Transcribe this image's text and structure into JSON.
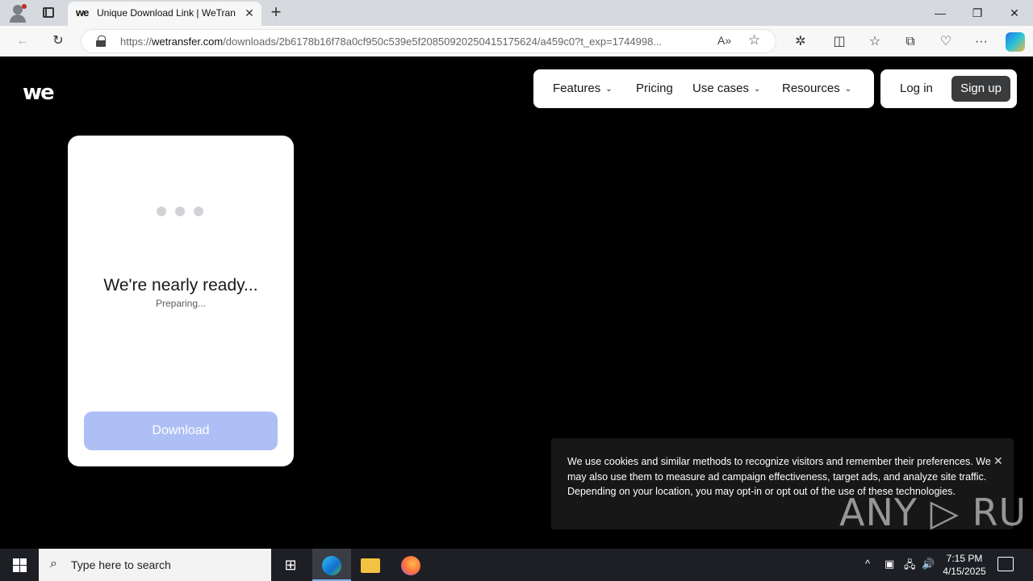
{
  "browser": {
    "tab_title": "Unique Download Link | WeTransfer",
    "tab_favicon": "we",
    "url_host": "wetransfer.com",
    "url_prefix": "https://",
    "url_path": "/downloads/2b6178b16f78a0cf950c539e5f20850920250415175624/a459c0?t_exp=1744998...",
    "window_controls": {
      "minimize": "—",
      "restore": "❐",
      "close": "✕"
    },
    "new_tab": "+",
    "tab_close": "✕"
  },
  "site": {
    "logo": "we",
    "nav": [
      {
        "label": "Features",
        "has_dropdown": true
      },
      {
        "label": "Pricing",
        "has_dropdown": false
      },
      {
        "label": "Use cases",
        "has_dropdown": true
      },
      {
        "label": "Resources",
        "has_dropdown": true
      }
    ],
    "login": "Log in",
    "signup": "Sign up"
  },
  "card": {
    "headline": "We're nearly ready...",
    "status": "Preparing...",
    "download_button": "Download",
    "download_color": "#aebff5"
  },
  "cookie": {
    "message": "We use cookies and similar methods to recognize visitors and remember their preferences. We may also use them to measure ad campaign effectiveness, target ads, and analyze site traffic. Depending on your location, you may opt-in or opt out of the use of these technologies.",
    "close": "✕"
  },
  "watermark": "ANY ▷ RUN",
  "taskbar": {
    "search_placeholder": "Type here to search",
    "time": "7:15 PM",
    "date": "4/15/2025"
  }
}
